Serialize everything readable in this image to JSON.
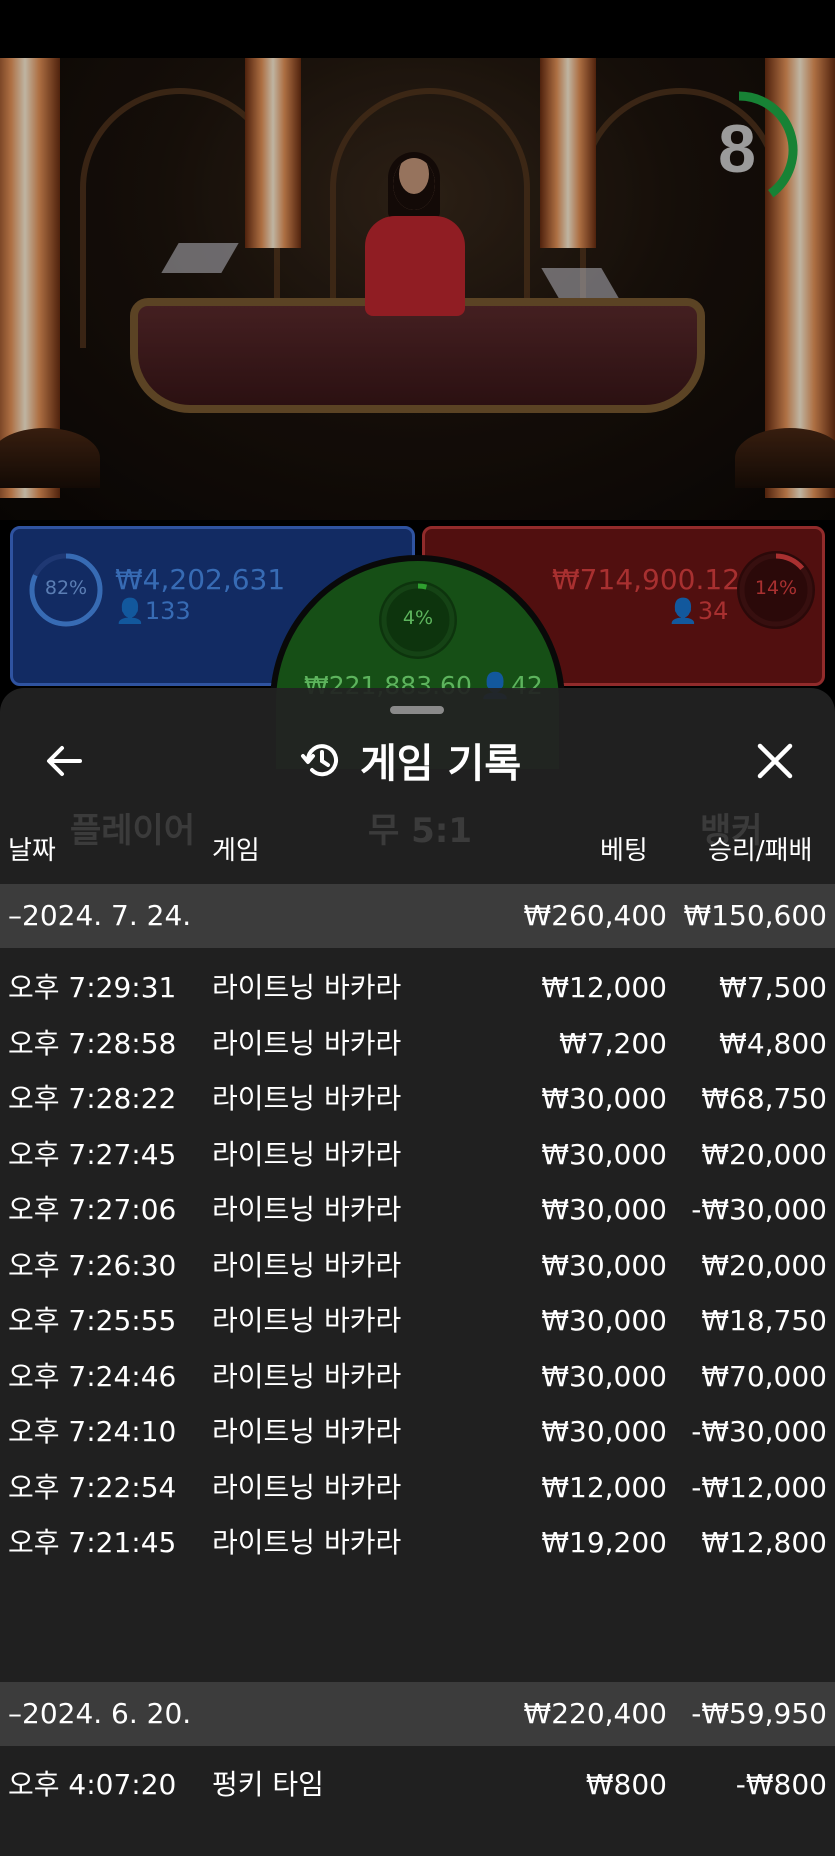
{
  "timer": {
    "value": "8",
    "progress": 0.4,
    "color": "#1fae47"
  },
  "bets": {
    "player": {
      "percent": "82%",
      "percent_value": 0.82,
      "amount": "₩4,202,631",
      "count": "133",
      "color": "#3f6fd6"
    },
    "tie": {
      "percent": "4%",
      "percent_value": 0.04,
      "amount": "₩221,883.60",
      "count": "42",
      "color": "#3fd63f"
    },
    "banker": {
      "percent": "14%",
      "percent_value": 0.14,
      "amount": "₩714,900.12",
      "count": "34",
      "color": "#e04040"
    }
  },
  "sheet": {
    "title": "게임 기록",
    "back_icon": "arrow-left-icon",
    "history_icon": "history-icon",
    "close_icon": "close-icon",
    "columns": {
      "date": "날짜",
      "game": "게임",
      "bet": "베팅",
      "result": "승리/패배"
    },
    "groups": [
      {
        "date": "–2024. 7. 24.",
        "bet": "₩260,400",
        "result": "₩150,600",
        "rows": [
          {
            "time": "오후 7:29:31",
            "game": "라이트닝 바카라",
            "bet": "₩12,000",
            "result": "₩7,500"
          },
          {
            "time": "오후 7:28:58",
            "game": "라이트닝 바카라",
            "bet": "₩7,200",
            "result": "₩4,800"
          },
          {
            "time": "오후 7:28:22",
            "game": "라이트닝 바카라",
            "bet": "₩30,000",
            "result": "₩68,750"
          },
          {
            "time": "오후 7:27:45",
            "game": "라이트닝 바카라",
            "bet": "₩30,000",
            "result": "₩20,000"
          },
          {
            "time": "오후 7:27:06",
            "game": "라이트닝 바카라",
            "bet": "₩30,000",
            "result": "-₩30,000"
          },
          {
            "time": "오후 7:26:30",
            "game": "라이트닝 바카라",
            "bet": "₩30,000",
            "result": "₩20,000"
          },
          {
            "time": "오후 7:25:55",
            "game": "라이트닝 바카라",
            "bet": "₩30,000",
            "result": "₩18,750"
          },
          {
            "time": "오후 7:24:46",
            "game": "라이트닝 바카라",
            "bet": "₩30,000",
            "result": "₩70,000"
          },
          {
            "time": "오후 7:24:10",
            "game": "라이트닝 바카라",
            "bet": "₩30,000",
            "result": "-₩30,000"
          },
          {
            "time": "오후 7:22:54",
            "game": "라이트닝 바카라",
            "bet": "₩12,000",
            "result": "-₩12,000"
          },
          {
            "time": "오후 7:21:45",
            "game": "라이트닝 바카라",
            "bet": "₩19,200",
            "result": "₩12,800"
          }
        ]
      },
      {
        "date": "–2024. 6. 20.",
        "bet": "₩220,400",
        "result": "-₩59,950",
        "rows": [
          {
            "time": "오후 4:07:20",
            "game": "펑키 타임",
            "bet": "₩800",
            "result": "-₩800"
          }
        ]
      }
    ]
  },
  "background_labels": {
    "player": "플레이어",
    "tie": "무 5:1",
    "banker": "뱅커"
  }
}
